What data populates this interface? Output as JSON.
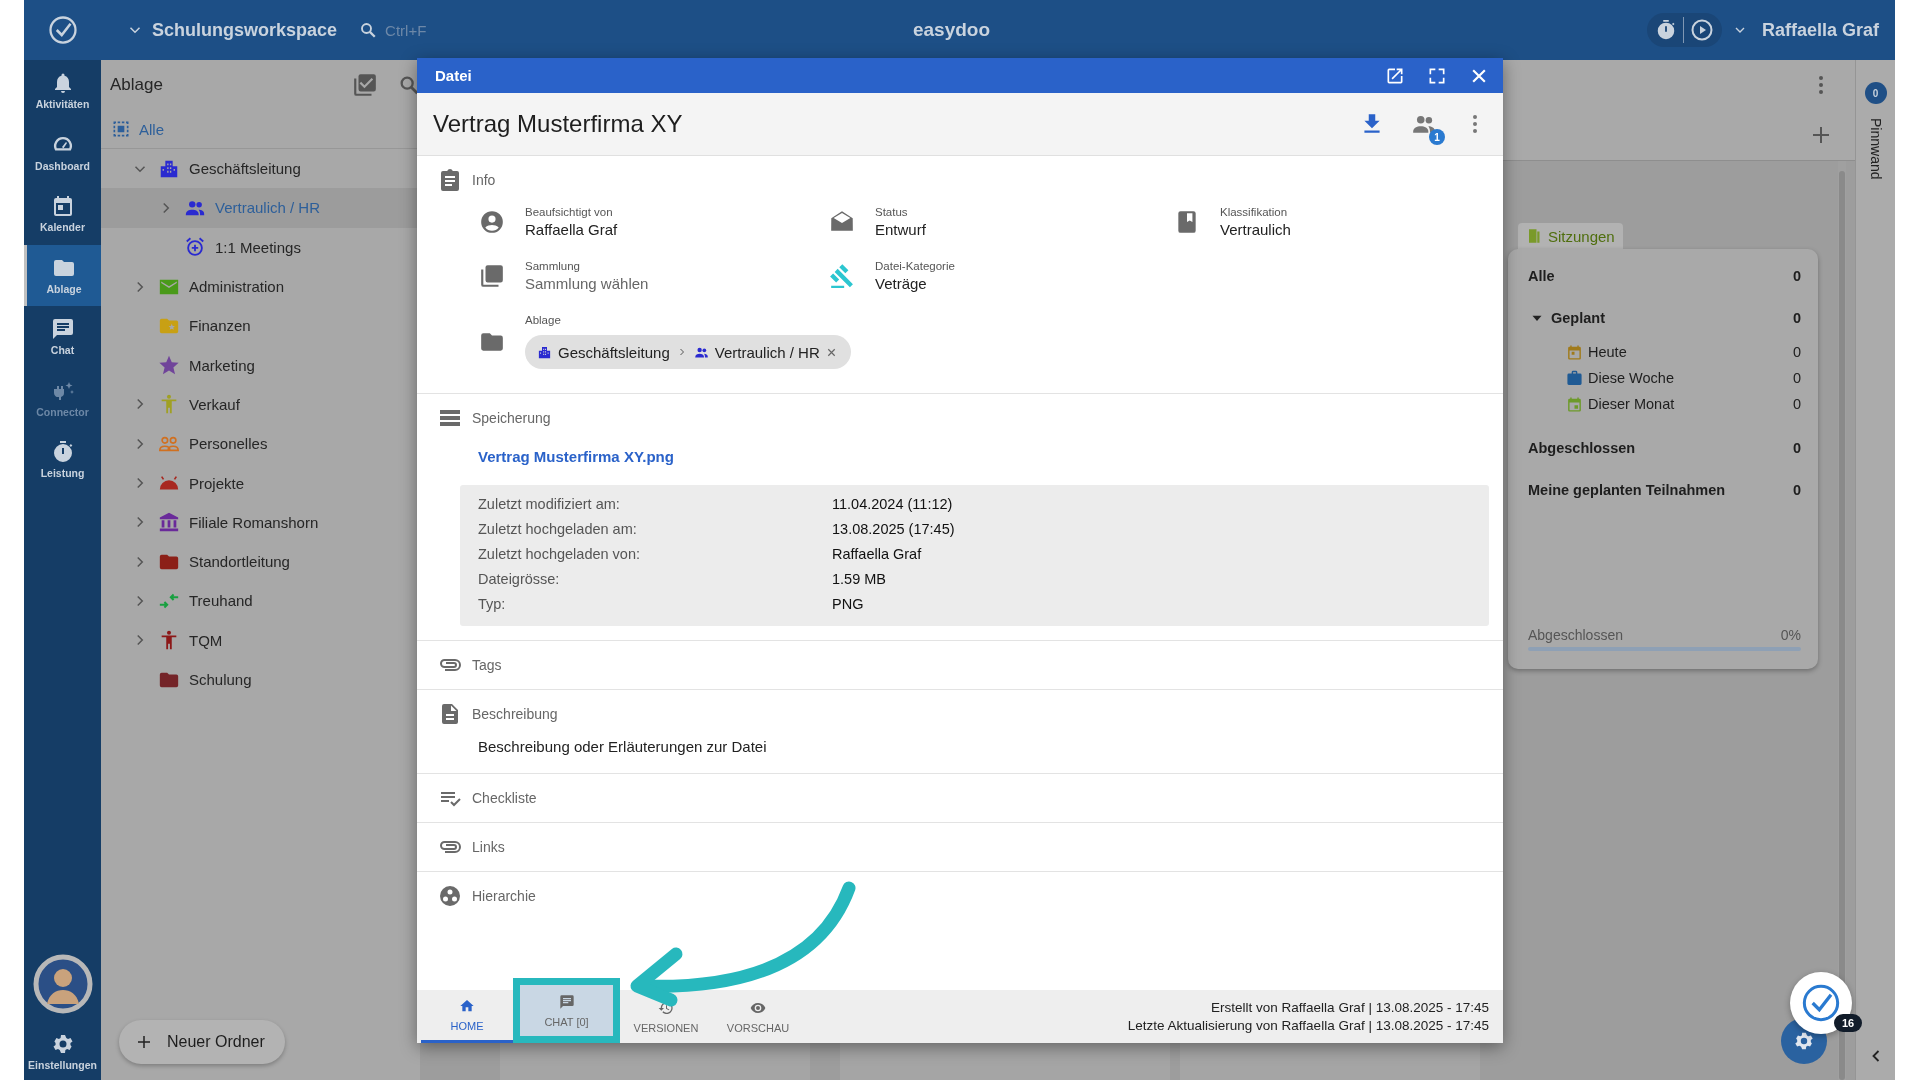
{
  "top_bar": {
    "workspace": "Schulungsworkspace",
    "search_hint": "Ctrl+F",
    "app_name": "easydoo",
    "user": "Raffaella Graf"
  },
  "nav_rail": {
    "items": [
      {
        "kind": "bell",
        "label": "Aktivitäten",
        "selected": false,
        "disabled": false
      },
      {
        "kind": "gauge",
        "label": "Dashboard",
        "selected": false,
        "disabled": false
      },
      {
        "kind": "calendar",
        "label": "Kalender",
        "selected": false,
        "disabled": false
      },
      {
        "kind": "folder",
        "label": "Ablage",
        "selected": true,
        "disabled": false
      },
      {
        "kind": "chat",
        "label": "Chat",
        "selected": false,
        "disabled": false
      },
      {
        "kind": "plug",
        "label": "Connector",
        "selected": false,
        "disabled": true
      },
      {
        "kind": "stopwatch",
        "label": "Leistung",
        "selected": false,
        "disabled": false
      }
    ],
    "settings_label": "Einstellungen"
  },
  "folder_panel": {
    "title": "Ablage",
    "all_label": "Alle",
    "tree": [
      {
        "kind": "building",
        "label": "Geschäftsleitung",
        "color": "#2a2ad0",
        "expandable": true,
        "expanded": true,
        "selected": false,
        "children": [
          {
            "kind": "people",
            "label": "Vertraulich / HR",
            "color": "#2a2ad0",
            "expandable": true,
            "expanded": false,
            "selected": true
          },
          {
            "kind": "alarm",
            "label": "1:1 Meetings",
            "color": "#2a2ad0",
            "expandable": false,
            "expanded": false,
            "selected": false
          }
        ]
      },
      {
        "kind": "mail",
        "label": "Administration",
        "color": "#4a9a1a",
        "expandable": true,
        "expanded": false,
        "selected": false
      },
      {
        "kind": "folder-star",
        "label": "Finanzen",
        "color": "#c8a014",
        "expandable": false,
        "expanded": false,
        "selected": false
      },
      {
        "kind": "star",
        "label": "Marketing",
        "color": "#70449a",
        "expandable": false,
        "expanded": false,
        "selected": false
      },
      {
        "kind": "person",
        "label": "Verkauf",
        "color": "#a0a024",
        "expandable": true,
        "expanded": false,
        "selected": false
      },
      {
        "kind": "group",
        "label": "Personelles",
        "color": "#d07020",
        "expandable": true,
        "expanded": false,
        "selected": false
      },
      {
        "kind": "robot",
        "label": "Projekte",
        "color": "#a82820",
        "expandable": true,
        "expanded": false,
        "selected": false
      },
      {
        "kind": "bank",
        "label": "Filiale Romanshorn",
        "color": "#6a2a9a",
        "expandable": true,
        "expanded": false,
        "selected": false
      },
      {
        "kind": "folder",
        "label": "Standortleitung",
        "color": "#8c2018",
        "expandable": true,
        "expanded": false,
        "selected": false
      },
      {
        "kind": "arrows",
        "label": "Treuhand",
        "color": "#18a040",
        "expandable": true,
        "expanded": false,
        "selected": false
      },
      {
        "kind": "person",
        "label": "TQM",
        "color": "#8c1818",
        "expandable": true,
        "expanded": false,
        "selected": false
      },
      {
        "kind": "folder",
        "label": "Schulung",
        "color": "#742428",
        "expandable": false,
        "expanded": false,
        "selected": false
      }
    ],
    "new_folder_button": "Neuer Ordner"
  },
  "dialog": {
    "title": "Datei",
    "heading": "Vertrag Musterfirma XY",
    "share_count": "1",
    "info": {
      "label": "Info",
      "fields": [
        {
          "kind": "person",
          "label": "Beaufsichtigt von",
          "value": "Raffaella Graf"
        },
        {
          "kind": "status",
          "label": "Status",
          "value": "Entwurf"
        },
        {
          "kind": "classification",
          "label": "Klassifikation",
          "value": "Vertraulich"
        },
        {
          "kind": "collection",
          "label": "Sammlung",
          "placeholder": "Sammlung wählen"
        },
        {
          "kind": "category",
          "label": "Datei-Kategorie",
          "value": "Veträge"
        }
      ],
      "location": {
        "label": "Ablage",
        "path": [
          {
            "kind": "building",
            "label": "Geschäftsleitung"
          },
          {
            "kind": "people",
            "label": "Vertraulich / HR"
          }
        ]
      }
    },
    "storage": {
      "label": "Speicherung",
      "file_link": "Vertrag Musterfirma XY.png",
      "details": [
        {
          "label": "Zuletzt modifiziert am:",
          "value": "11.04.2024 (11:12)"
        },
        {
          "label": "Zuletzt hochgeladen am:",
          "value": "13.08.2025 (17:45)"
        },
        {
          "label": "Zuletzt hochgeladen von:",
          "value": "Raffaella Graf"
        },
        {
          "label": "Dateigrösse:",
          "value": "1.59 MB"
        },
        {
          "label": "Typ:",
          "value": "PNG"
        }
      ]
    },
    "sections": [
      {
        "kind": "tags",
        "label": "Tags"
      },
      {
        "kind": "description",
        "label": "Beschreibung",
        "text": "Beschreibung oder Erläuterungen zur Datei"
      },
      {
        "kind": "checklist",
        "label": "Checkliste"
      },
      {
        "kind": "links",
        "label": "Links"
      },
      {
        "kind": "hierarchy",
        "label": "Hierarchie"
      }
    ],
    "tabs": [
      {
        "kind": "home",
        "label": "HOME",
        "selected": true,
        "highlighted": false
      },
      {
        "kind": "chat",
        "label": "CHAT [0]",
        "selected": false,
        "highlighted": true
      },
      {
        "kind": "history",
        "label": "VERSIONEN",
        "selected": false,
        "highlighted": false
      },
      {
        "kind": "eye",
        "label": "VORSCHAU",
        "selected": false,
        "highlighted": false
      }
    ],
    "footer": [
      "Erstellt von Raffaella Graf | 13.08.2025 - 17:45",
      "Letzte Aktualisierung von Raffaella Graf | 13.08.2025 - 17:45"
    ]
  },
  "sessions_card": {
    "title": "Sitzungen",
    "rows": [
      {
        "kind": "total",
        "label": "Alle",
        "count": "0"
      },
      {
        "kind": "group",
        "label": "Geplant",
        "count": "0",
        "expanded": true,
        "children": [
          {
            "kind": "day",
            "label": "Heute",
            "count": "0",
            "color": "#a07a1a"
          },
          {
            "kind": "week",
            "label": "Diese Woche",
            "count": "0",
            "color": "#1f5a94"
          },
          {
            "kind": "month",
            "label": "Dieser Monat",
            "count": "0",
            "color": "#6d9a2a"
          }
        ]
      },
      {
        "kind": "total",
        "label": "Abgeschlossen",
        "count": "0"
      },
      {
        "kind": "total",
        "label": "Meine geplanten Teilnahmen",
        "count": "0"
      }
    ],
    "progress": {
      "label": "Abgeschlossen",
      "reading": "0%",
      "level": 0
    }
  },
  "pinboard": {
    "label": "Pinnwand",
    "count": "0"
  },
  "assistant_button": {
    "badge": "16"
  }
}
